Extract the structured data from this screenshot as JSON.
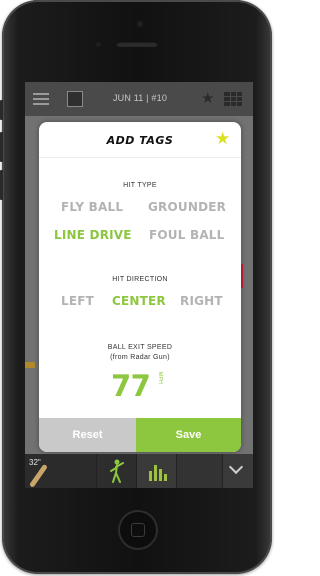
{
  "topbar": {
    "date_label": "JUN 11 | #10",
    "menu_icon": "hamburger-menu-icon",
    "star_icon": "star-icon",
    "grid_icon": "calendar-grid-icon"
  },
  "modal": {
    "title": "ADD TAGS",
    "favorite_icon": "star-icon",
    "hit_type": {
      "label": "HIT TYPE",
      "options": [
        {
          "label": "FLY BALL",
          "selected": false
        },
        {
          "label": "GROUNDER",
          "selected": false
        },
        {
          "label": "LINE DRIVE",
          "selected": true
        },
        {
          "label": "FOUL BALL",
          "selected": false
        }
      ]
    },
    "hit_direction": {
      "label": "HIT DIRECTION",
      "options": [
        {
          "label": "LEFT",
          "selected": false
        },
        {
          "label": "CENTER",
          "selected": true
        },
        {
          "label": "RIGHT",
          "selected": false
        }
      ]
    },
    "exit_speed": {
      "label": "BALL EXIT SPEED",
      "sublabel": "(from Radar Gun)",
      "value": "77",
      "unit": "MPH"
    },
    "reset_label": "Reset",
    "save_label": "Save"
  },
  "bottombar": {
    "bat_size": "32\"",
    "golf_icon": "swing-player-icon",
    "stats_icon": "bar-chart-icon",
    "chevron_icon": "chevron-down-icon"
  },
  "colors": {
    "accent": "#8dc63f",
    "star": "#d9e021",
    "inactive": "#b3b3b3",
    "reset_bg": "#c9c9c9"
  }
}
